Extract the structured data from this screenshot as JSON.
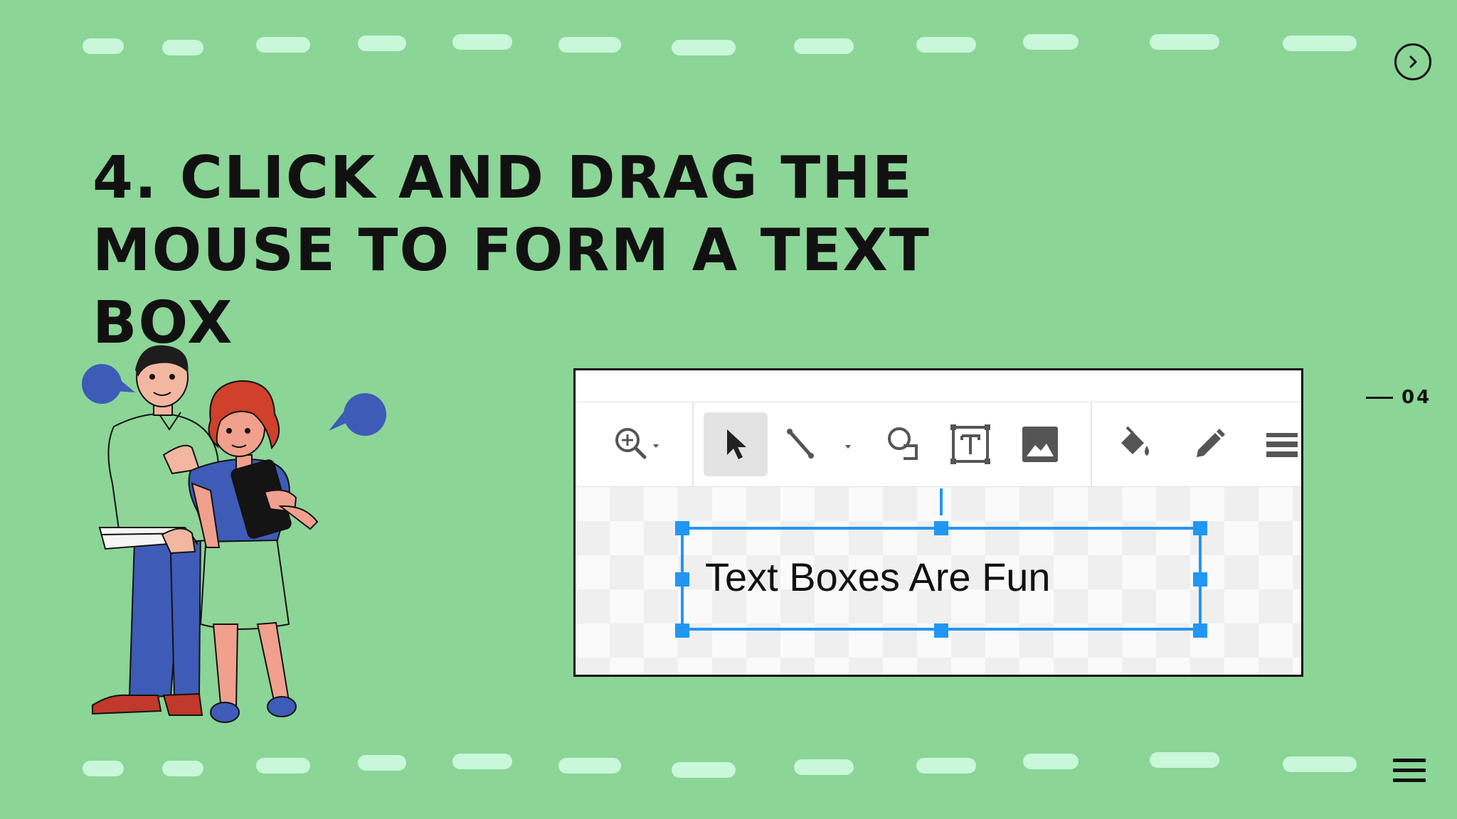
{
  "slide": {
    "title_line1": "4. Click and drag the",
    "title_line2": "mouse to form a text box",
    "page_number": "04"
  },
  "navigation": {
    "next_icon": "chevron-right-icon",
    "menu_icon": "hamburger-menu-icon"
  },
  "screenshot": {
    "toolbar_tools": [
      "zoom-icon",
      "select-arrow-icon",
      "line-icon",
      "shape-icon",
      "text-box-icon",
      "image-icon",
      "fill-color-icon",
      "pencil-icon",
      "line-weight-icon"
    ],
    "active_tool": "select-arrow-icon",
    "text_box_content": "Text Boxes Are Fun"
  },
  "colors": {
    "background": "#8bd597",
    "dashes": "#c8f7d9",
    "selection": "#2196f3",
    "text": "#111111"
  }
}
